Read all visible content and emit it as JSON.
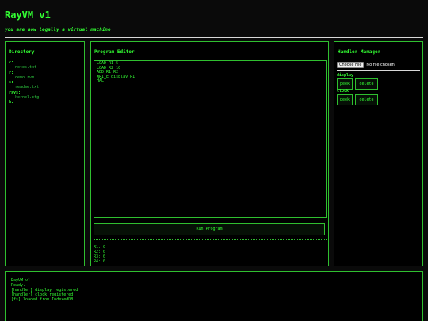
{
  "app": {
    "title": "RayVM v1",
    "subtitle": "you are now legally a virtual machine"
  },
  "directory": {
    "heading": "Directory",
    "drives": [
      {
        "label": "c:",
        "files": [
          "notes.txt"
        ]
      },
      {
        "label": "r:",
        "files": [
          "demo.rvm"
        ]
      },
      {
        "label": "s:",
        "files": [
          "readme.txt"
        ]
      },
      {
        "label": "rsys:",
        "files": [
          "kernel.cfg"
        ]
      },
      {
        "label": "h:",
        "files": []
      }
    ]
  },
  "editor": {
    "heading": "Program Editor",
    "code_lines": [
      "LOAD R1 5",
      "LOAD R2 10",
      "ADD R1 R2",
      "WRITE display R1",
      "HALT"
    ],
    "run_label": "Run Program",
    "registers": [
      "R1: 0",
      "R2: 0",
      "R3: 0",
      "R4: 0"
    ]
  },
  "handlers": {
    "heading": "Handler Manager",
    "choose_file_label": "Choose File",
    "no_file_label": "No file chosen",
    "items": [
      {
        "name": "display",
        "peek_label": "peek",
        "delete_label": "delete"
      },
      {
        "name": "clock",
        "peek_label": "peek",
        "delete_label": "delete"
      }
    ]
  },
  "console": {
    "lines": [
      "RayVM v1",
      "Ready.",
      "[handler] display registered",
      "[handler] clock registered",
      "[fs] loaded from IndexedDB"
    ]
  },
  "colors": {
    "background": "#0a0a0a",
    "accent_green": "#33ff33",
    "border_green": "#2fbf2f"
  }
}
